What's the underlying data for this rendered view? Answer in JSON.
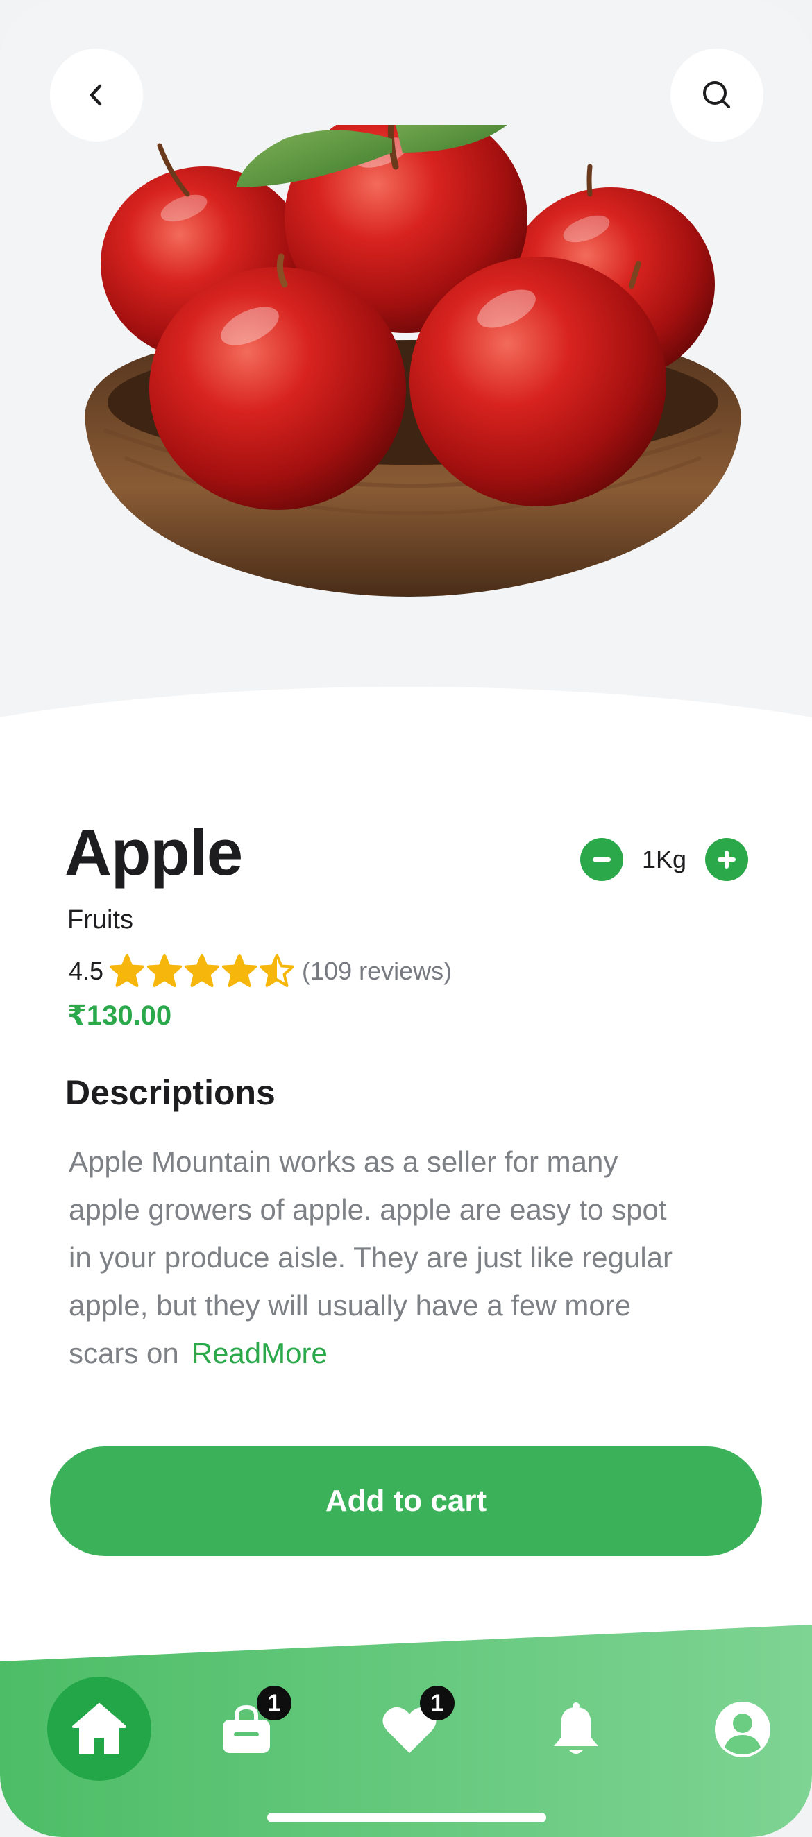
{
  "product": {
    "name": "Apple",
    "category": "Fruits",
    "rating": "4.5",
    "rating_value": 4.5,
    "rating_max": 5,
    "reviews": "(109 reviews)",
    "price": "₹130.00",
    "quantity": "1Kg",
    "image_icon": "apple-bowl-image"
  },
  "description": {
    "title": "Descriptions",
    "lines": [
      "Apple Mountain works as a seller for many",
      "apple growers of apple. apple are easy to spot",
      "in your produce aisle. They are just like regular",
      "apple, but they will usually have a few more",
      "scars on"
    ],
    "read_more": "ReadMore"
  },
  "actions": {
    "add_to_cart": "Add to cart"
  },
  "nav": {
    "items": [
      {
        "icon": "home-icon",
        "active": true
      },
      {
        "icon": "bag-icon",
        "badge": "1"
      },
      {
        "icon": "heart-icon",
        "badge": "1"
      },
      {
        "icon": "bell-icon"
      },
      {
        "icon": "profile-icon"
      }
    ]
  },
  "colors": {
    "accent": "#2aa84a",
    "button": "#3bb259",
    "star": "#f6b60b",
    "nav_gradient_start": "#4dbd67",
    "nav_gradient_end": "#7ed493"
  }
}
